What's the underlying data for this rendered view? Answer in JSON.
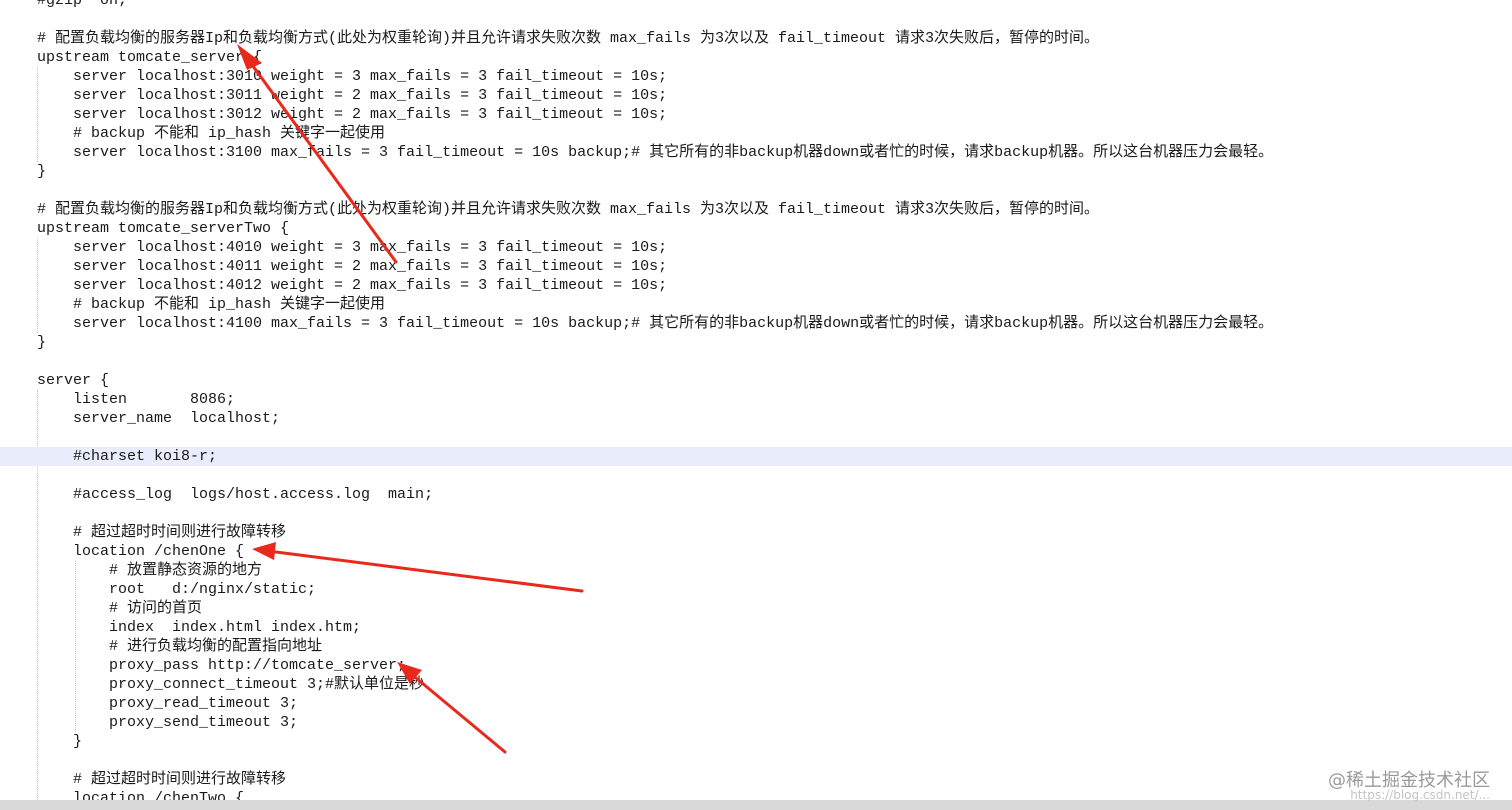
{
  "editor": {
    "lines": [
      "#gzip  on;",
      "",
      "# 配置负载均衡的服务器Ip和负载均衡方式(此处为权重轮询)并且允许请求失败次数 max_fails 为3次以及 fail_timeout 请求3次失败后，暂停的时间。",
      "upstream tomcate_server {",
      "    server localhost:3010 weight = 3 max_fails = 3 fail_timeout = 10s;",
      "    server localhost:3011 weight = 2 max_fails = 3 fail_timeout = 10s;",
      "    server localhost:3012 weight = 2 max_fails = 3 fail_timeout = 10s;",
      "    # backup 不能和 ip_hash 关键字一起使用",
      "    server localhost:3100 max_fails = 3 fail_timeout = 10s backup;# 其它所有的非backup机器down或者忙的时候，请求backup机器。所以这台机器压力会最轻。",
      "}",
      "",
      "# 配置负载均衡的服务器Ip和负载均衡方式(此处为权重轮询)并且允许请求失败次数 max_fails 为3次以及 fail_timeout 请求3次失败后，暂停的时间。",
      "upstream tomcate_serverTwo {",
      "    server localhost:4010 weight = 3 max_fails = 3 fail_timeout = 10s;",
      "    server localhost:4011 weight = 2 max_fails = 3 fail_timeout = 10s;",
      "    server localhost:4012 weight = 2 max_fails = 3 fail_timeout = 10s;",
      "    # backup 不能和 ip_hash 关键字一起使用",
      "    server localhost:4100 max_fails = 3 fail_timeout = 10s backup;# 其它所有的非backup机器down或者忙的时候，请求backup机器。所以这台机器压力会最轻。",
      "}",
      "",
      "server {",
      "    listen       8086;",
      "    server_name  localhost;",
      "",
      "    #charset koi8-r;",
      "",
      "    #access_log  logs/host.access.log  main;",
      "",
      "    # 超过超时时间则进行故障转移",
      "    location /chenOne {",
      "        # 放置静态资源的地方",
      "        root   d:/nginx/static;",
      "        # 访问的首页",
      "        index  index.html index.htm;",
      "        # 进行负载均衡的配置指向地址",
      "        proxy_pass http://tomcate_server;",
      "        proxy_connect_timeout 3;#默认单位是秒",
      "        proxy_read_timeout 3;",
      "        proxy_send_timeout 3;",
      "    }",
      "",
      "    # 超过超时时间则进行故障转移",
      "    location /chenTwo {"
    ]
  },
  "watermark": {
    "text": "@稀土掘金技术社区",
    "url": "https://blog.csdn.net/..."
  },
  "colors": {
    "highlight_line": "#e8ecfb",
    "arrow": "#e8291c"
  }
}
